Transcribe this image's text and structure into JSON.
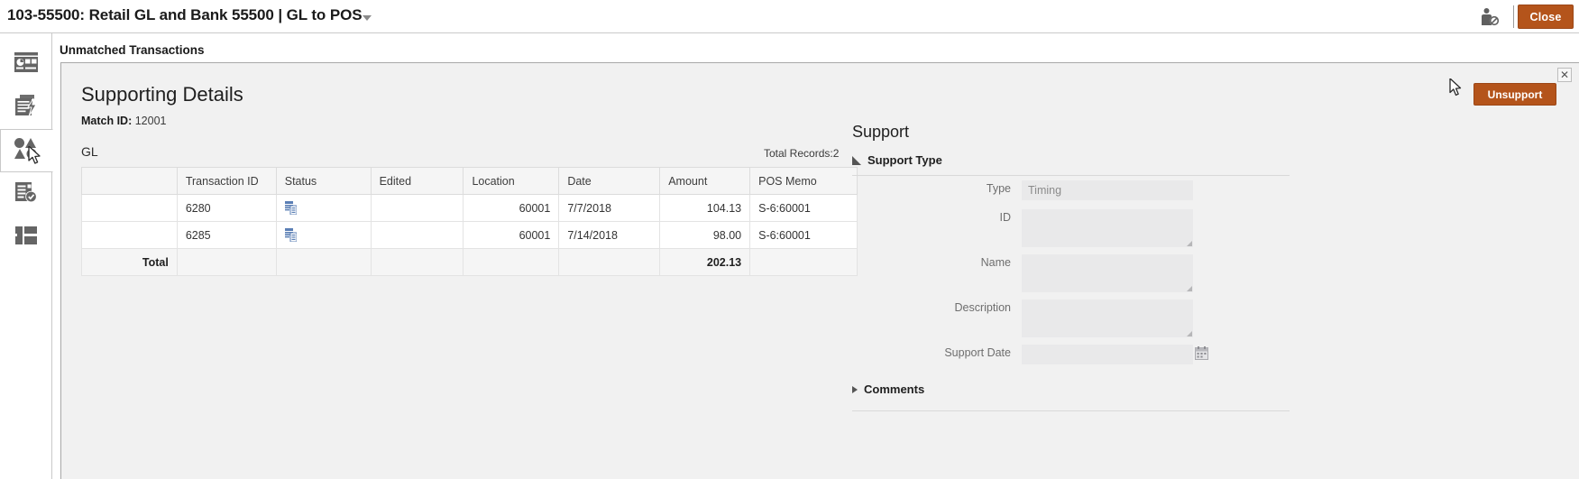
{
  "appbar": {
    "title": "103-55500: Retail GL and Bank 55500 | GL to POS",
    "user_icon": "user-restricted-icon",
    "close_label": "Close"
  },
  "rail": {
    "items": [
      {
        "name": "dashboard-icon",
        "selected": false
      },
      {
        "name": "document-lightning-icon",
        "selected": false
      },
      {
        "name": "shapes-icon",
        "selected": true
      },
      {
        "name": "document-check-icon",
        "selected": false
      },
      {
        "name": "list-layout-icon",
        "selected": false
      }
    ]
  },
  "panel": {
    "header": "Unmatched Transactions",
    "title": "Supporting Details",
    "match_id_label": "Match ID:",
    "match_id_value": "12001",
    "unsupport_label": "Unsupport",
    "close_icon": "close-icon"
  },
  "gl": {
    "section_label": "GL",
    "total_records": "Total Records:2",
    "columns": [
      "",
      "Transaction ID",
      "Status",
      "Edited",
      "Location",
      "Date",
      "Amount",
      "POS Memo"
    ],
    "rows": [
      {
        "select": "",
        "transaction_id": "6280",
        "status_icon": "report-icon",
        "edited": "",
        "location": "60001",
        "date": "7/7/2018",
        "amount": "104.13",
        "pos_memo": "S-6:60001"
      },
      {
        "select": "",
        "transaction_id": "6285",
        "status_icon": "report-icon",
        "edited": "",
        "location": "60001",
        "date": "7/14/2018",
        "amount": "98.00",
        "pos_memo": "S-6:60001"
      }
    ],
    "total_row": {
      "label": "Total",
      "amount": "202.13"
    }
  },
  "support": {
    "heading": "Support",
    "support_type_section": "Support Type",
    "comments_section": "Comments",
    "fields": [
      {
        "label": "Type",
        "value": "Timing"
      },
      {
        "label": "ID",
        "value": ""
      },
      {
        "label": "Name",
        "value": ""
      },
      {
        "label": "Description",
        "value": ""
      },
      {
        "label": "Support Date",
        "value": ""
      }
    ],
    "calendar_icon": "calendar-icon"
  },
  "colors": {
    "accent": "#b4541b",
    "panel_bg": "#f1f1f1",
    "field_bg": "#e9e9ea",
    "icon_gray": "#656565",
    "status_blue": "#4a6fa5"
  }
}
